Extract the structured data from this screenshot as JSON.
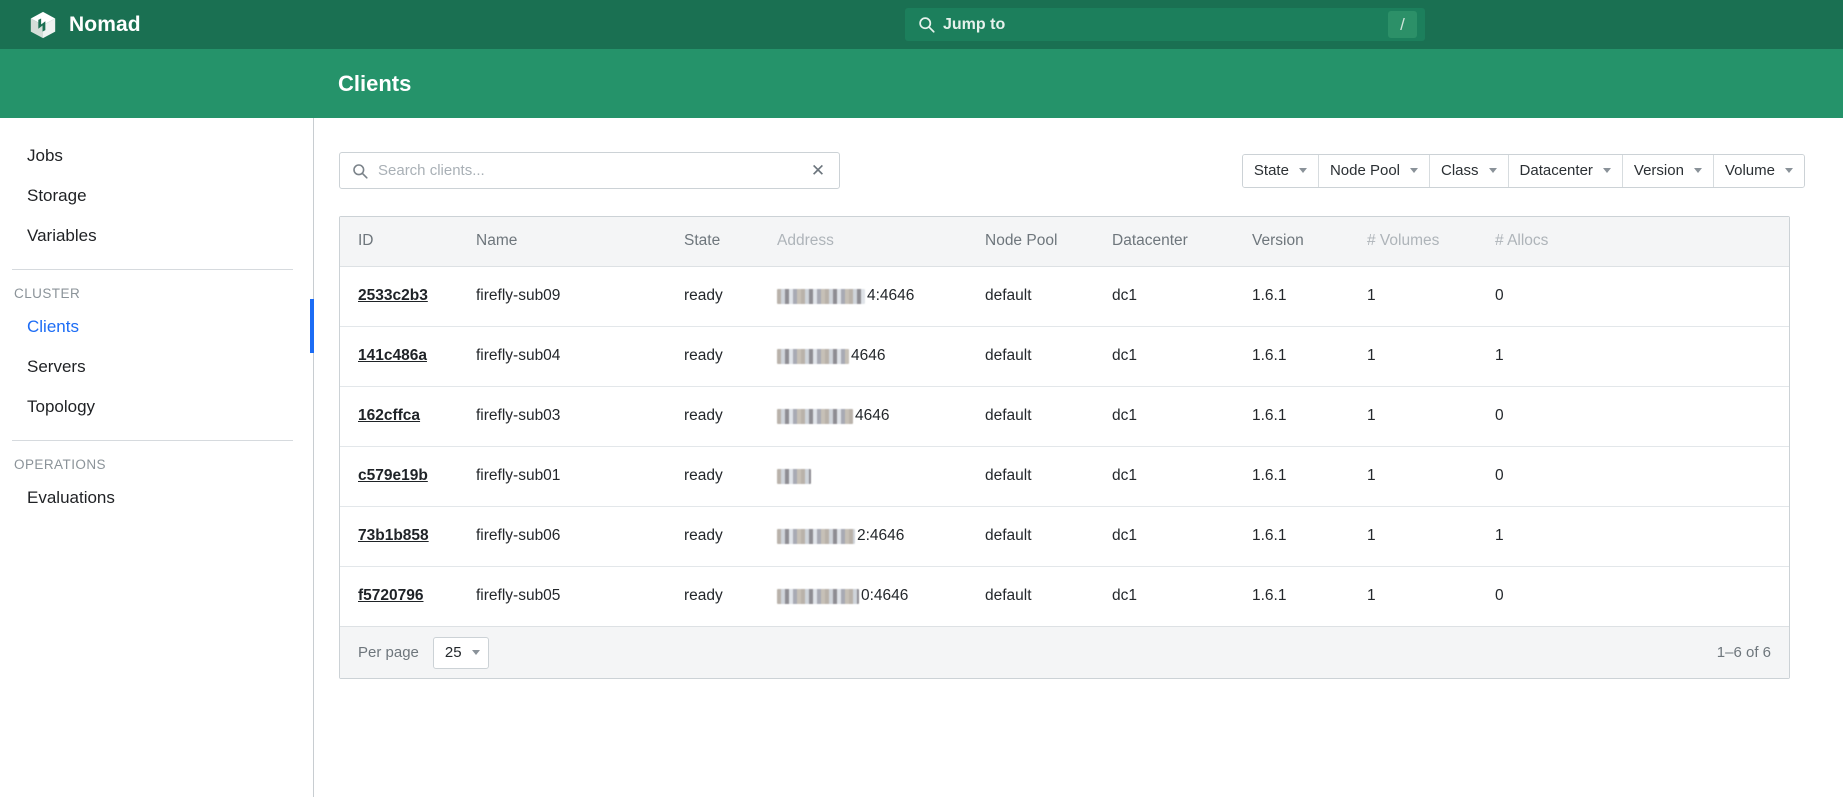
{
  "global_bar": {
    "brand_name": "Nomad",
    "logo_icon": "nomad-cube-icon",
    "jump_to": {
      "icon": "search-icon",
      "label": "Jump to",
      "shortcut_key": "/"
    }
  },
  "subnav": {
    "page_title": "Clients"
  },
  "sidebar": {
    "items": [
      {
        "label": "Jobs",
        "active": false
      },
      {
        "label": "Storage",
        "active": false
      },
      {
        "label": "Variables",
        "active": false
      }
    ],
    "cluster_heading": "CLUSTER",
    "cluster_items": [
      {
        "label": "Clients",
        "active": true
      },
      {
        "label": "Servers",
        "active": false
      },
      {
        "label": "Topology",
        "active": false
      }
    ],
    "operations_heading": "OPERATIONS",
    "operations_items": [
      {
        "label": "Evaluations",
        "active": false
      }
    ]
  },
  "toolbar": {
    "search": {
      "icon": "search-icon",
      "placeholder": "Search clients...",
      "value": "",
      "clear_icon": "close-icon"
    },
    "filters": [
      {
        "label": "State"
      },
      {
        "label": "Node Pool"
      },
      {
        "label": "Class"
      },
      {
        "label": "Datacenter"
      },
      {
        "label": "Version"
      },
      {
        "label": "Volume"
      }
    ]
  },
  "table": {
    "columns": [
      {
        "label": "ID",
        "sortable": true
      },
      {
        "label": "Name",
        "sortable": true
      },
      {
        "label": "State",
        "sortable": true
      },
      {
        "label": "Address",
        "sortable": false
      },
      {
        "label": "Node Pool",
        "sortable": true
      },
      {
        "label": "Datacenter",
        "sortable": true
      },
      {
        "label": "Version",
        "sortable": true
      },
      {
        "label": "# Volumes",
        "sortable": false
      },
      {
        "label": "# Allocs",
        "sortable": false
      }
    ],
    "rows": [
      {
        "id": "2533c2b3",
        "name": "firefly-sub09",
        "state": "ready",
        "address_redacted_width": 88,
        "address_tail": "4:4646",
        "node_pool": "default",
        "datacenter": "dc1",
        "version": "1.6.1",
        "volumes": "1",
        "allocs": "0"
      },
      {
        "id": "141c486a",
        "name": "firefly-sub04",
        "state": "ready",
        "address_redacted_width": 72,
        "address_tail": "4646",
        "node_pool": "default",
        "datacenter": "dc1",
        "version": "1.6.1",
        "volumes": "1",
        "allocs": "1"
      },
      {
        "id": "162cffca",
        "name": "firefly-sub03",
        "state": "ready",
        "address_redacted_width": 76,
        "address_tail": "4646",
        "node_pool": "default",
        "datacenter": "dc1",
        "version": "1.6.1",
        "volumes": "1",
        "allocs": "0"
      },
      {
        "id": "c579e19b",
        "name": "firefly-sub01",
        "state": "ready",
        "address_redacted_width": 34,
        "address_tail": "",
        "node_pool": "default",
        "datacenter": "dc1",
        "version": "1.6.1",
        "volumes": "1",
        "allocs": "0"
      },
      {
        "id": "73b1b858",
        "name": "firefly-sub06",
        "state": "ready",
        "address_redacted_width": 78,
        "address_tail": "2:4646",
        "node_pool": "default",
        "datacenter": "dc1",
        "version": "1.6.1",
        "volumes": "1",
        "allocs": "1"
      },
      {
        "id": "f5720796",
        "name": "firefly-sub05",
        "state": "ready",
        "address_redacted_width": 82,
        "address_tail": "0:4646",
        "node_pool": "default",
        "datacenter": "dc1",
        "version": "1.6.1",
        "volumes": "1",
        "allocs": "0"
      }
    ]
  },
  "footer": {
    "per_page_label": "Per page",
    "per_page_value": "25",
    "page_range": "1–6 of 6"
  },
  "colors": {
    "brand_dark_green": "#1a7052",
    "brand_green": "#25936a",
    "active_blue": "#1c6cf5",
    "border_gray": "#ccd2d6",
    "header_bg": "#f4f5f6"
  }
}
